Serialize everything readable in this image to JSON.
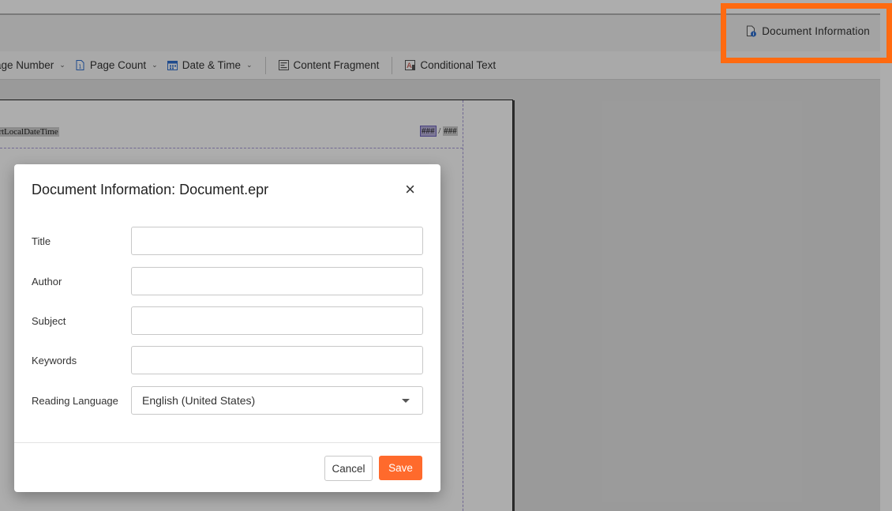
{
  "header": {
    "document_info_label": "Document Information"
  },
  "toolbar": {
    "page_number_label": "age Number",
    "page_count_label": "Page Count",
    "date_time_label": "Date & Time",
    "content_fragment_label": "Content Fragment",
    "conditional_text_label": "Conditional Text"
  },
  "page": {
    "header_left_field": "CrtLocalDateTime",
    "header_page_current": "###",
    "header_page_separator": "/",
    "header_page_total": "###"
  },
  "dialog": {
    "title": "Document Information: Document.epr",
    "close_glyph": "×",
    "fields": {
      "title_label": "Title",
      "title_value": "",
      "author_label": "Author",
      "author_value": "",
      "subject_label": "Subject",
      "subject_value": "",
      "keywords_label": "Keywords",
      "keywords_value": "",
      "reading_language_label": "Reading Language",
      "reading_language_value": "English (United States)"
    },
    "cancel_label": "Cancel",
    "save_label": "Save"
  },
  "colors": {
    "accent": "#ff6a2c",
    "highlight_border": "#ff6a10",
    "overlay": "rgba(0,0,0,0.32)",
    "icon_blue": "#2f6fd0"
  },
  "icons": {
    "document_info": "document-info-icon",
    "page_number": "page-number-icon",
    "page_count": "page-count-icon",
    "date_time": "calendar-icon",
    "content_fragment": "content-fragment-icon",
    "conditional_text": "conditional-text-icon"
  }
}
